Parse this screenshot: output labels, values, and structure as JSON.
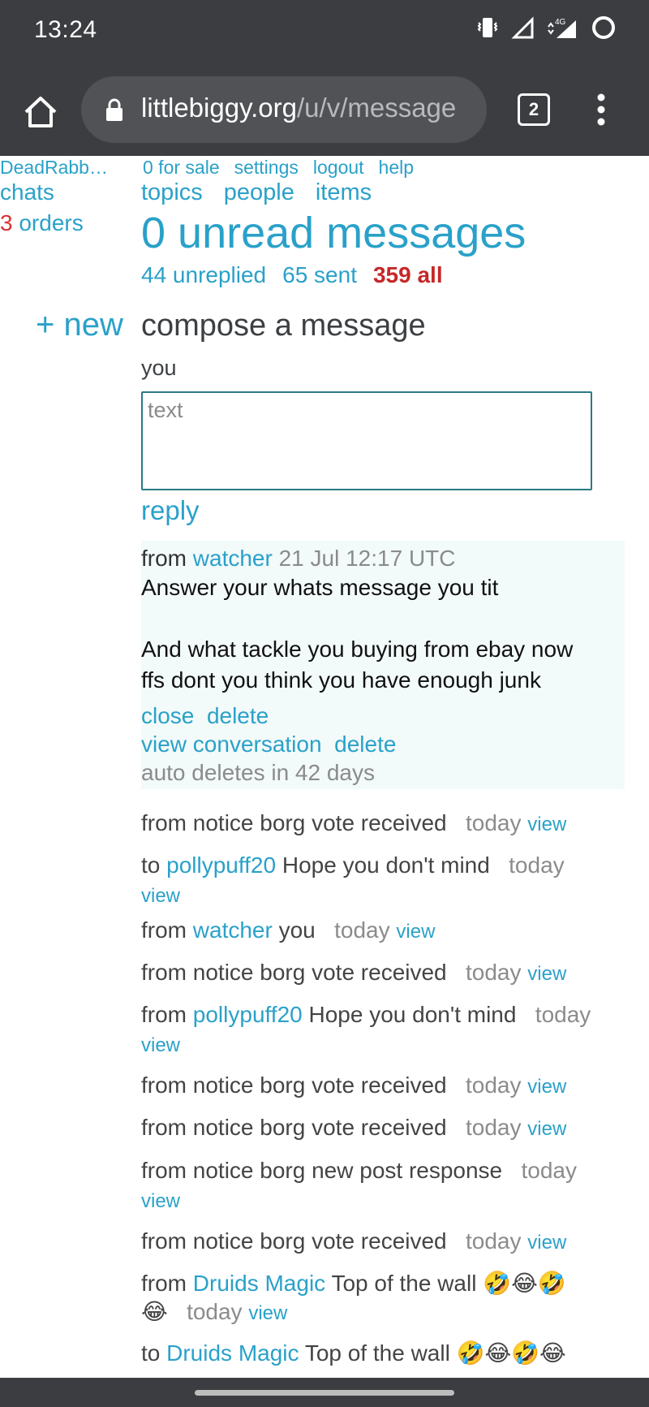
{
  "status": {
    "time": "13:24",
    "network": "4G"
  },
  "browser": {
    "url_host": "littlebiggy.org",
    "url_path": "/u/v/message",
    "tab_count": "2"
  },
  "sidebar": {
    "username": "DeadRabb…",
    "chats": "chats",
    "orders_count": "3",
    "orders_label": "orders"
  },
  "topnav": {
    "for_sale": "0 for sale",
    "settings": "settings",
    "logout": "logout",
    "help": "help"
  },
  "mainnav": {
    "topics": "topics",
    "people": "people",
    "items": "items"
  },
  "header": {
    "title": "0 unread messages",
    "unreplied": "44 unreplied",
    "sent": "65 sent",
    "all": "359 all"
  },
  "compose": {
    "new_label": "+ new",
    "title": "compose a message",
    "recipient": "you",
    "placeholder": "text",
    "reply_label": "reply"
  },
  "expanded_message": {
    "from_label": "from",
    "sender": "watcher",
    "timestamp": "21 Jul 12:17 UTC",
    "body_line1": "Answer your whats message you tit",
    "body_line2": "And what tackle you buying from ebay now",
    "body_line3": "ffs dont you think you have enough junk",
    "close": "close",
    "delete": "delete",
    "view_conversation": "view conversation",
    "delete2": "delete",
    "auto_delete": "auto deletes in 42 days"
  },
  "messages": [
    {
      "prefix": "from notice borg vote received",
      "sender": "",
      "text": "",
      "date": "today",
      "view": "view"
    },
    {
      "prefix": "to",
      "sender": "pollypuff20",
      "text": "Hope you don't mind",
      "date": "today",
      "view": "view"
    },
    {
      "prefix": "from",
      "sender": "watcher",
      "text": "you",
      "date": "today",
      "view": "view"
    },
    {
      "prefix": "from notice borg vote received",
      "sender": "",
      "text": "",
      "date": "today",
      "view": "view"
    },
    {
      "prefix": "from",
      "sender": "pollypuff20",
      "text": "Hope you don't mind",
      "date": "today",
      "view": "view"
    },
    {
      "prefix": "from notice borg vote received",
      "sender": "",
      "text": "",
      "date": "today",
      "view": "view"
    },
    {
      "prefix": "from notice borg vote received",
      "sender": "",
      "text": "",
      "date": "today",
      "view": "view"
    },
    {
      "prefix": "from notice borg new post response",
      "sender": "",
      "text": "",
      "date": "today",
      "view": "view"
    },
    {
      "prefix": "from notice borg vote received",
      "sender": "",
      "text": "",
      "date": "today",
      "view": "view"
    },
    {
      "prefix": "from",
      "sender": "Druids Magic",
      "text": "Top of the wall 🤣😂🤣",
      "text2": "😂",
      "date": "today",
      "view": "view"
    },
    {
      "prefix": "to",
      "sender": "Druids Magic",
      "text": "Top of the wall 🤣😂🤣😂",
      "date": "",
      "view": ""
    }
  ]
}
